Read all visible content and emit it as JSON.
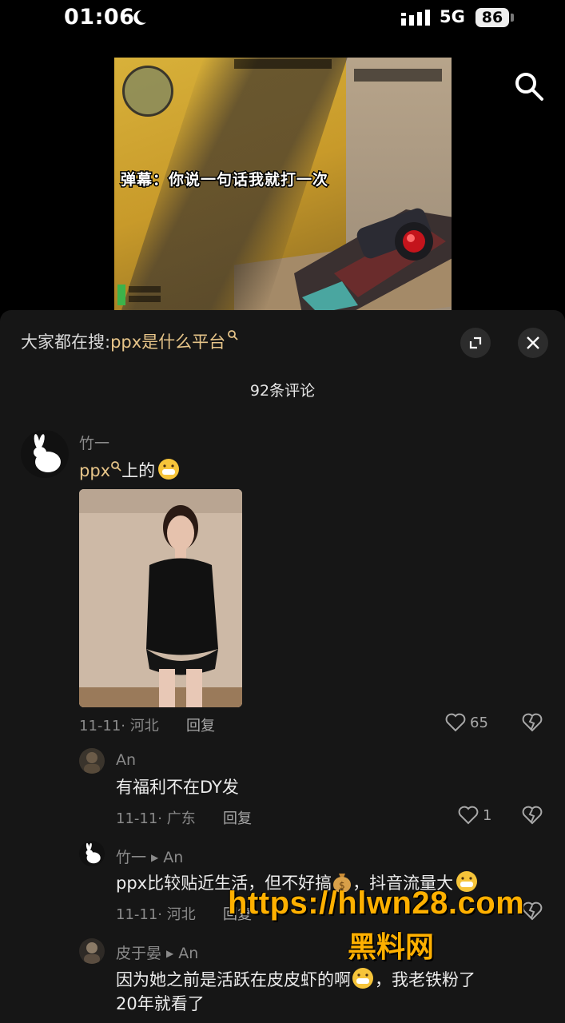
{
  "status_bar": {
    "time": "01:06",
    "network": "5G",
    "battery": "86"
  },
  "video": {
    "danmu_text": "弹幕：你说一句话我就打一次"
  },
  "comments_panel": {
    "trending_prefix": "大家都在搜:",
    "trending_keyword": "ppx是什么平台",
    "comment_count": "92条评论"
  },
  "comments": [
    {
      "username": "竹一",
      "text_link": "ppx",
      "text": "上的",
      "meta": "11-11· 河北",
      "reply_label": "回复",
      "likes": "65"
    },
    {
      "username": "An",
      "text": "有福利不在DY发",
      "meta": "11-11· 广东",
      "reply_label": "回复",
      "likes": "1"
    },
    {
      "username": "竹一",
      "reply_to": "An",
      "text_part1": "ppx比较贴近生活，但不好搞",
      "text_part2": "，抖音流量大",
      "meta": "11-11· 河北",
      "reply_label": "回复"
    },
    {
      "username": "皮于晏",
      "reply_to": "An",
      "text_line1_a": "因为她之前是活跃在皮皮虾的啊",
      "text_line1_b": "，我老铁粉了",
      "text_line2": "20年就看了"
    }
  ],
  "watermark": {
    "url": "https://hlwn28.com",
    "subtitle": "黑料网"
  },
  "colors": {
    "keyword": "#e7c589",
    "background": "#161616",
    "watermark": "#ffb000"
  }
}
